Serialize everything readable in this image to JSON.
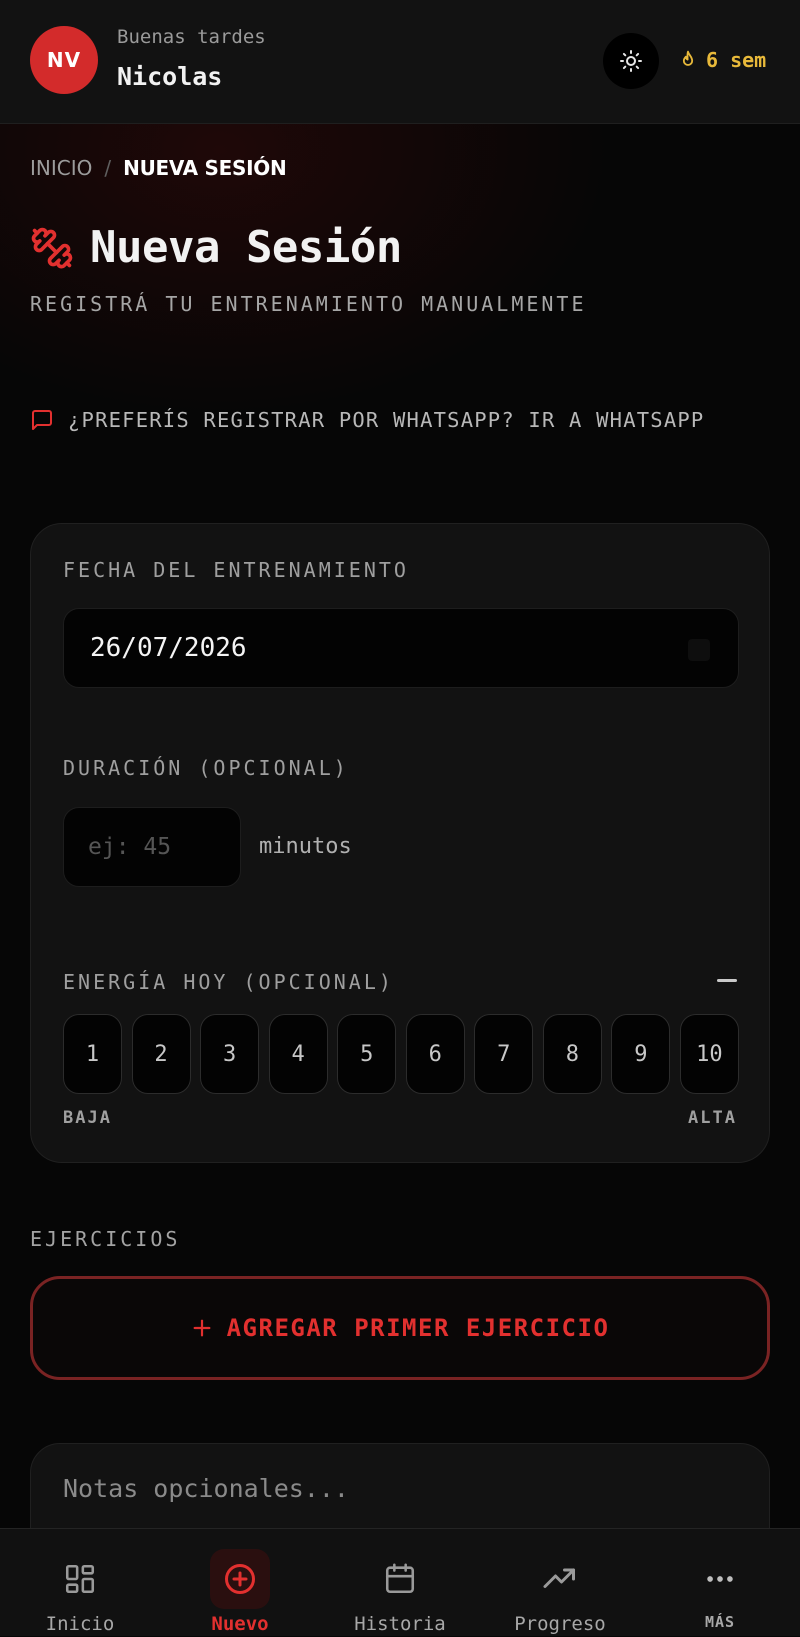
{
  "header": {
    "avatar_initials": "NV",
    "greeting": "Buenas tardes",
    "user_name": "Nicolas",
    "streak": "6 sem"
  },
  "breadcrumb": {
    "home": "INICIO",
    "separator": "/",
    "current": "NUEVA SESIÓN"
  },
  "page": {
    "title": "Nueva Sesión",
    "subtitle": "REGISTRÁ TU ENTRENAMIENTO MANUALMENTE",
    "whatsapp_link": "¿PREFERÍS REGISTRAR POR WHATSAPP? IR A WHATSAPP"
  },
  "form": {
    "date_label": "FECHA DEL ENTRENAMIENTO",
    "date_value": "26/07/2026",
    "duration_label": "DURACIÓN (OPCIONAL)",
    "duration_placeholder": "ej: 45",
    "duration_unit": "minutos",
    "energy_label": "ENERGÍA HOY (OPCIONAL)",
    "energy_levels": [
      "1",
      "2",
      "3",
      "4",
      "5",
      "6",
      "7",
      "8",
      "9",
      "10"
    ],
    "energy_low": "BAJA",
    "energy_high": "ALTA"
  },
  "exercises": {
    "section_label": "EJERCICIOS",
    "add_button": "AGREGAR PRIMER EJERCICIO"
  },
  "notes": {
    "placeholder": "Notas opcionales..."
  },
  "nav": {
    "items": [
      {
        "label": "Inicio",
        "icon": "grid-icon"
      },
      {
        "label": "Nuevo",
        "icon": "plus-circle-icon",
        "active": true
      },
      {
        "label": "Historia",
        "icon": "calendar-icon"
      },
      {
        "label": "Progreso",
        "icon": "trending-up-icon"
      },
      {
        "label": "MÁS",
        "icon": "more-dots-icon"
      }
    ]
  },
  "colors": {
    "accent": "#e2302f",
    "avatar": "#d32b2b",
    "streak": "#e8b93a",
    "background": "#060606",
    "card": "#121212"
  }
}
